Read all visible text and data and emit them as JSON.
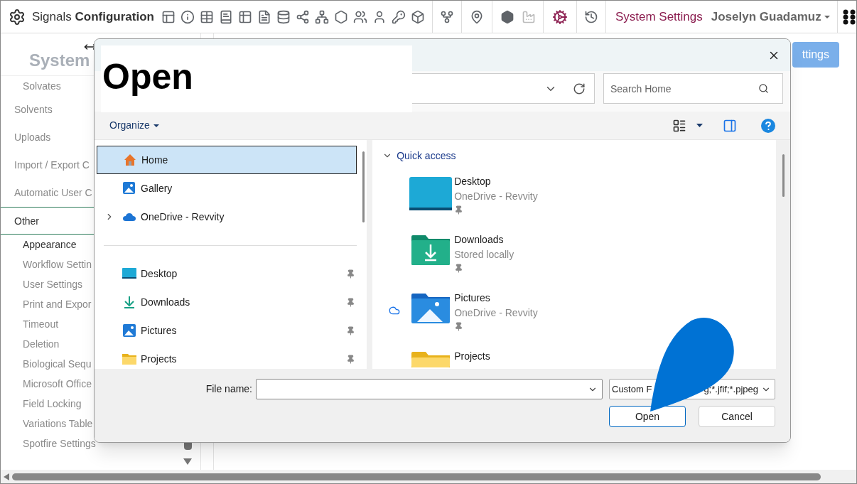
{
  "header": {
    "title": "Signals **Configuration**",
    "nav_link": "System Settings",
    "user": "Joselyn Guadamuz"
  },
  "sidebar": {
    "heading": "System",
    "partial_children": [
      {
        "label": "Solvates",
        "selected": false
      }
    ],
    "items": [
      {
        "label": "Solvents",
        "selected": false
      },
      {
        "label": "Uploads",
        "selected": false
      },
      {
        "label": "Import / Export C",
        "selected": false
      },
      {
        "label": "Automatic User C",
        "selected": false
      },
      {
        "label": "Other",
        "selected": true,
        "children": [
          {
            "label": "Appearance",
            "selected": true
          },
          {
            "label": "Workflow Settin",
            "selected": false
          },
          {
            "label": "User Settings",
            "selected": false
          },
          {
            "label": "Print and Expor",
            "selected": false
          },
          {
            "label": "Timeout",
            "selected": false
          },
          {
            "label": "Deletion",
            "selected": false
          },
          {
            "label": "Biological Sequ",
            "selected": false
          },
          {
            "label": "Microsoft Office",
            "selected": false
          },
          {
            "label": "Field Locking",
            "selected": false
          },
          {
            "label": "Variations Table",
            "selected": false
          },
          {
            "label": "Spotfire Settings",
            "selected": false
          }
        ]
      }
    ]
  },
  "main": {
    "button": "ttings"
  },
  "dialog": {
    "title": "Open",
    "search_placeholder": "Search Home",
    "organize": "Organize",
    "nav_top": [
      {
        "label": "Home",
        "kind": "home",
        "selected": true
      },
      {
        "label": "Gallery",
        "kind": "gallery",
        "selected": false
      },
      {
        "label": "OneDrive - Revvity",
        "kind": "cloud",
        "selected": false,
        "expanded": false
      }
    ],
    "nav_pinned": [
      {
        "label": "Desktop",
        "kind": "desktop",
        "selected": false,
        "pinned": true
      },
      {
        "label": "Downloads",
        "kind": "downloads",
        "selected": false,
        "pinned": true
      },
      {
        "label": "Pictures",
        "kind": "pictures",
        "selected": false,
        "pinned": true
      },
      {
        "label": "Projects",
        "kind": "folder",
        "selected": false,
        "pinned": true
      }
    ],
    "quick_access": {
      "label": "Quick access",
      "expanded": true,
      "items": [
        {
          "name": "Desktop",
          "location": "OneDrive - Revvity",
          "kind": "desktop",
          "pinned": true,
          "cloud": false
        },
        {
          "name": "Downloads",
          "location": "Stored locally",
          "kind": "downloads",
          "pinned": true,
          "cloud": false
        },
        {
          "name": "Pictures",
          "location": "OneDrive - Revvity",
          "kind": "pictures",
          "pinned": true,
          "cloud": true
        },
        {
          "name": "Projects",
          "kind": "folder",
          "pinned": false,
          "cloud": false
        }
      ]
    },
    "file_name": {
      "label": "File name:"
    },
    "file_type": {
      "visible_start": "Custom F",
      "visible_end": "g;*.jfif;*.pjpeg"
    },
    "buttons": [
      {
        "label": "Open",
        "default": true
      },
      {
        "label": "Cancel",
        "default": false
      }
    ]
  }
}
